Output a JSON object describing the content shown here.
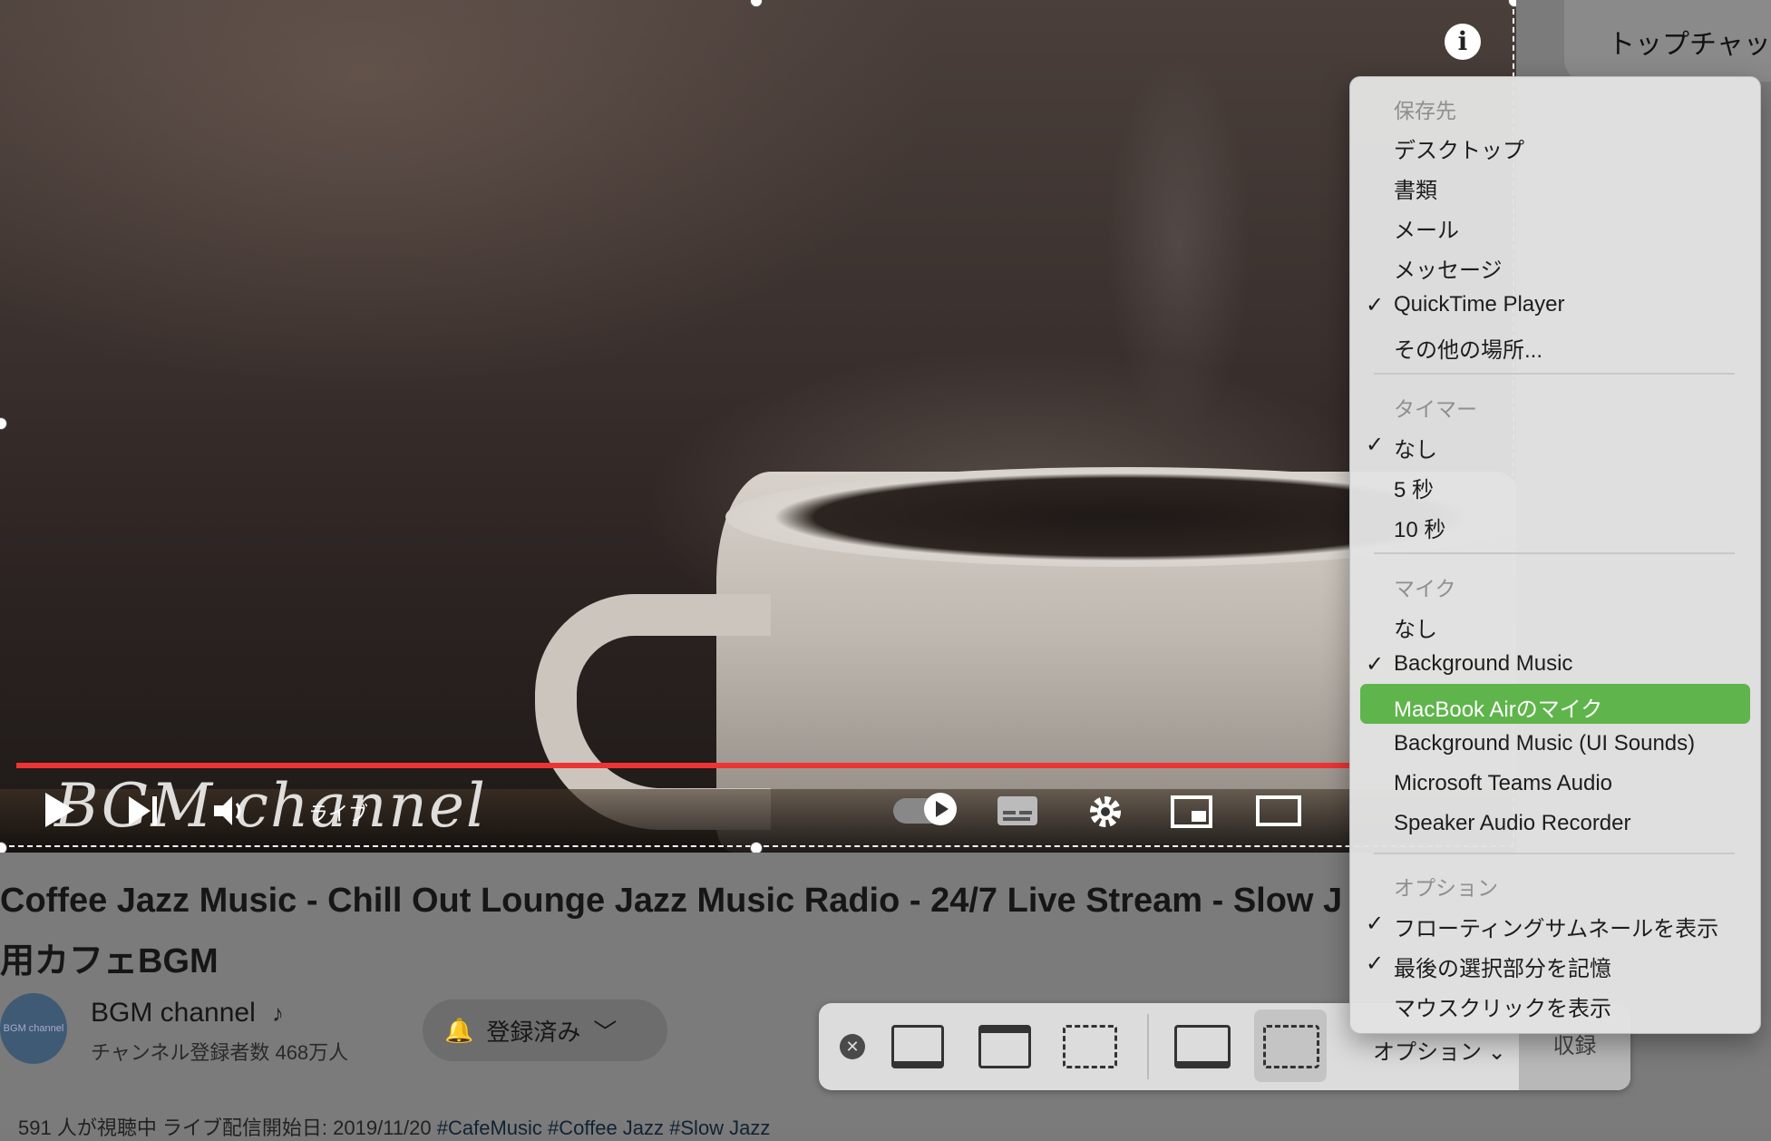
{
  "video": {
    "info_icon": "info-icon",
    "watermark": "BGM channel",
    "live_label": "ライブ",
    "controls": {
      "play_icon": "play-icon",
      "next_icon": "next-icon",
      "volume_icon": "volume-icon",
      "autoplay_icon": "autoplay-toggle-icon",
      "subtitles_icon": "subtitles-icon",
      "settings_icon": "gear-icon",
      "miniplayer_icon": "miniplayer-icon",
      "theater_icon": "theater-icon"
    },
    "progress_color": "#e33333"
  },
  "page": {
    "title_line1": "Coffee Jazz Music - Chill Out Lounge Jazz Music Radio - 24/7 Live Stream - Slow J",
    "title_line2": "用カフェBGM",
    "channel": {
      "name": "BGM channel",
      "avatar_text": "BGM channel",
      "subscribers": "チャンネル登録者数 468万人"
    },
    "subscribe_label": "登録済み",
    "bottom_text": "591 人が視聴中  ライブ配信開始日: 2019/11/20",
    "bottom_tags": "#CafeMusic #Coffee Jazz #Slow Jazz"
  },
  "side": {
    "top_chat": "トップチャッ"
  },
  "toolbar": {
    "close_icon": "close-icon",
    "options_label": "オプション",
    "record_label": "収録",
    "icons": [
      "capture-entire-screen-icon",
      "capture-window-icon",
      "capture-selection-icon",
      "record-entire-screen-icon",
      "record-selection-icon"
    ]
  },
  "menu": {
    "save_header": "保存先",
    "save_items": [
      "デスクトップ",
      "書類",
      "メール",
      "メッセージ",
      "QuickTime Player",
      "その他の場所..."
    ],
    "timer_header": "タイマー",
    "timer_items": [
      "なし",
      "5 秒",
      "10 秒"
    ],
    "mic_header": "マイク",
    "mic_items": [
      "なし",
      "Background Music",
      "MacBook Airのマイク",
      "Background Music (UI Sounds)",
      "Microsoft Teams Audio",
      "Speaker Audio Recorder"
    ],
    "options_header": "オプション",
    "options_items": [
      "フローティングサムネールを表示",
      "最後の選択部分を記憶",
      "マウスクリックを表示"
    ],
    "checked": {
      "save": "QuickTime Player",
      "timer": "なし",
      "mic": "Background Music",
      "options": [
        "フローティングサムネールを表示",
        "最後の選択部分を記憶"
      ]
    },
    "highlighted": "MacBook Airのマイク",
    "highlight_color": "#5fb54b"
  }
}
